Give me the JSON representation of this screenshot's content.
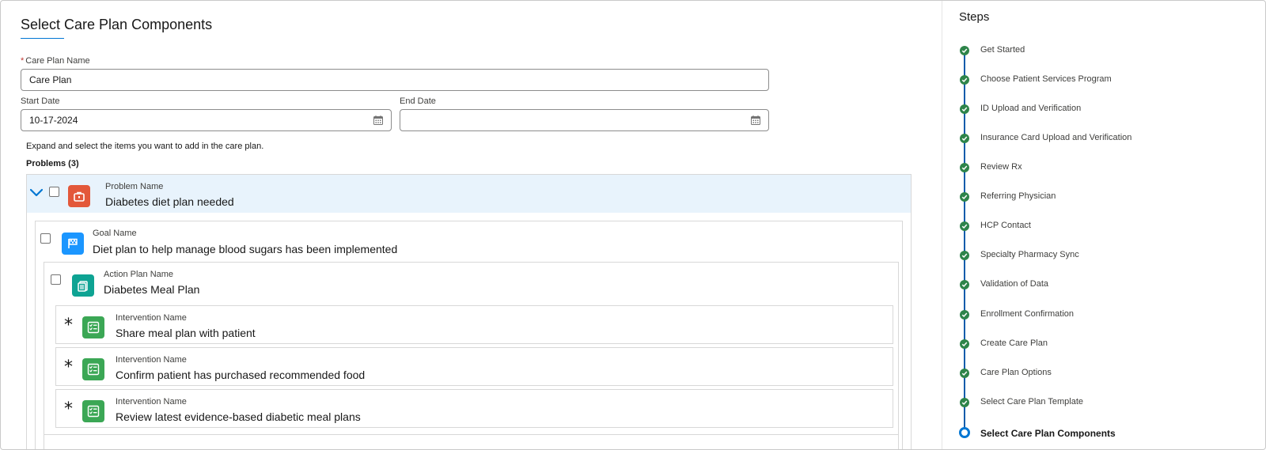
{
  "page": {
    "title": "Select Care Plan Components"
  },
  "form": {
    "name_label": "Care Plan Name",
    "name_required_mark": "*",
    "name_value": "Care Plan",
    "start_label": "Start Date",
    "start_value": "10-17-2024",
    "end_label": "End Date",
    "end_value": ""
  },
  "hint": "Expand and select the items you want to add in the care plan.",
  "problems": {
    "heading": "Problems (3)",
    "problem": {
      "label": "Problem Name",
      "value": "Diabetes diet plan needed"
    },
    "goal": {
      "label": "Goal Name",
      "value": "Diet plan to help manage blood sugars has been implemented"
    },
    "action_plan": {
      "label": "Action Plan Name",
      "value": "Diabetes Meal Plan"
    },
    "interventions": [
      {
        "label": "Intervention Name",
        "value": "Share meal plan with patient",
        "marker": "*"
      },
      {
        "label": "Intervention Name",
        "value": "Confirm patient has purchased recommended food",
        "marker": "*"
      },
      {
        "label": "Intervention Name",
        "value": "Review latest evidence-based diabetic meal plans",
        "marker": "*"
      }
    ]
  },
  "steps": {
    "title": "Steps",
    "items": [
      {
        "label": "Get Started",
        "status": "complete"
      },
      {
        "label": "Choose Patient Services Program",
        "status": "complete"
      },
      {
        "label": "ID Upload and Verification",
        "status": "complete"
      },
      {
        "label": "Insurance Card Upload and Verification",
        "status": "complete"
      },
      {
        "label": "Review Rx",
        "status": "complete"
      },
      {
        "label": "Referring Physician",
        "status": "complete"
      },
      {
        "label": "HCP Contact",
        "status": "complete"
      },
      {
        "label": "Specialty Pharmacy Sync",
        "status": "complete"
      },
      {
        "label": "Validation of Data",
        "status": "complete"
      },
      {
        "label": "Enrollment Confirmation",
        "status": "complete"
      },
      {
        "label": "Create Care Plan",
        "status": "complete"
      },
      {
        "label": "Care Plan Options",
        "status": "complete"
      },
      {
        "label": "Select Care Plan Template",
        "status": "complete"
      },
      {
        "label": "Select Care Plan Components",
        "status": "current"
      }
    ]
  },
  "colors": {
    "accent": "#0176d3",
    "complete": "#2e844a",
    "problem_icon": "#e3583a",
    "goal_icon": "#1b96ff",
    "action_plan_icon": "#0ea393",
    "intervention_icon": "#3ba755",
    "selected_row": "#e8f3fc"
  },
  "icons": {
    "problem": "briefcase-icon",
    "goal": "flag-icon",
    "action_plan": "clipboard-icon",
    "intervention": "checklist-icon",
    "date": "calendar-icon",
    "expand": "chevron-down-icon",
    "step_complete": "check-icon"
  }
}
